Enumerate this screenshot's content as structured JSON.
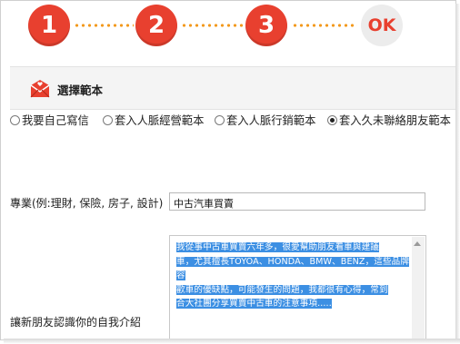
{
  "steps": {
    "step1": "1",
    "step2": "2",
    "step3": "3",
    "done": "OK"
  },
  "template_section": {
    "title": "選擇範本",
    "icon": "mail-heart-icon"
  },
  "template_options": [
    {
      "label": "我要自己寫信",
      "checked": false
    },
    {
      "label": "套入人脈經營範本",
      "checked": false
    },
    {
      "label": "套入人脈行銷範本",
      "checked": false
    },
    {
      "label": "套入久未聯絡朋友範本",
      "checked": true
    }
  ],
  "occupation": {
    "label": "專業(例:理財, 保險, 房子, 設計)",
    "value": "中古汽車買賣"
  },
  "self_intro": {
    "label": "讓新朋友認識你的自我介紹",
    "lines": [
      "我從事中古車買賣六年多，很愛幫助朋友看車與建議",
      "車，尤其擅長TOYOA、HONDA、BMW、BENZ，這些品牌容",
      "歡車的優缺點，可能發生的問題，我都很有心得，常到",
      "合大社團分享買賣中古車的注意事項....."
    ]
  },
  "colors": {
    "step_active": "#e8402f",
    "step_connector": "#f39a1e",
    "selection": "#3c8fe3"
  }
}
